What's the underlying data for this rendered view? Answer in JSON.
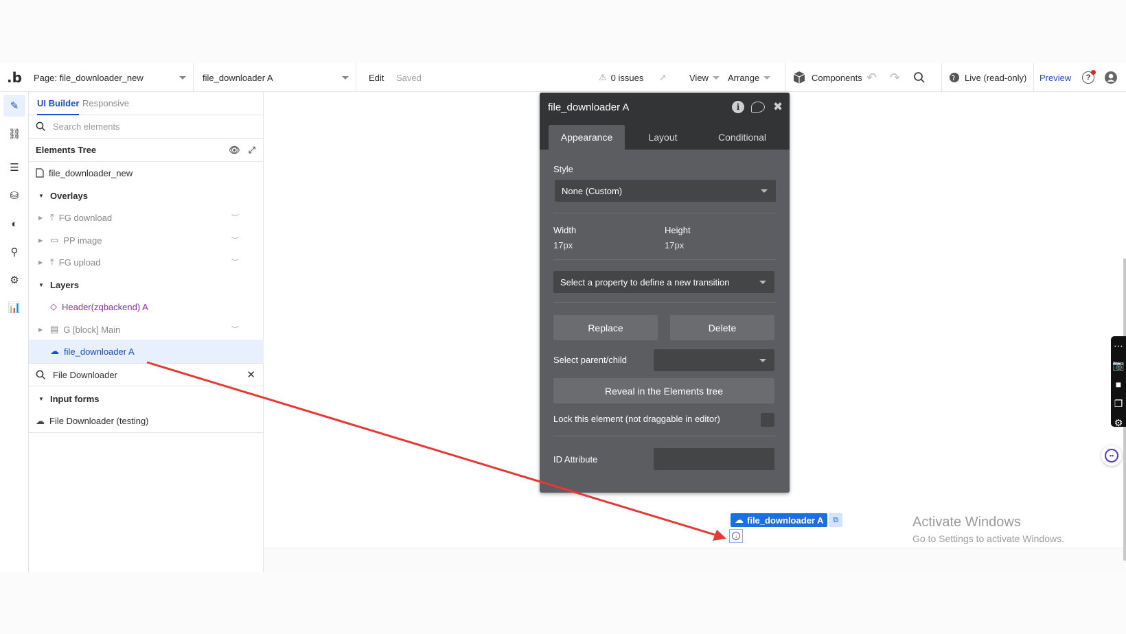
{
  "topbar": {
    "logo": ".b",
    "page_label": "Page: file_downloader_new",
    "element_label": "file_downloader A",
    "edit": "Edit",
    "saved": "Saved",
    "issues": "0 issues",
    "view": "View",
    "arrange": "Arrange",
    "components": "Components",
    "live": "Live (read-only)",
    "preview": "Preview"
  },
  "left_panel": {
    "tab_ui_builder": "UI Builder",
    "tab_responsive": "Responsive",
    "search_placeholder": "Search elements",
    "elements_tree": "Elements Tree",
    "page_item": "file_downloader_new",
    "overlays": "Overlays",
    "overlay_items": [
      "FG download",
      "PP image",
      "FG upload"
    ],
    "layers": "Layers",
    "layer_items": [
      "Header(zqbackend) A",
      "G [block] Main",
      "file_downloader A"
    ],
    "plugin_search_value": "File Downloader",
    "input_forms": "Input forms",
    "input_form_item": "File Downloader (testing)"
  },
  "property_editor": {
    "title": "file_downloader A",
    "tabs": [
      "Appearance",
      "Layout",
      "Conditional"
    ],
    "style_label": "Style",
    "style_value": "None (Custom)",
    "width_label": "Width",
    "width_value": "17px",
    "height_label": "Height",
    "height_value": "17px",
    "transition_placeholder": "Select a property to define a new transition",
    "replace": "Replace",
    "delete": "Delete",
    "parent_child_label": "Select parent/child",
    "reveal": "Reveal in the Elements tree",
    "lock_label": "Lock this element (not draggable in editor)",
    "id_label": "ID Attribute"
  },
  "canvas": {
    "element_badge": "file_downloader A"
  },
  "watermark": {
    "line1": "Activate Windows",
    "line2": "Go to Settings to activate Windows."
  },
  "colors": {
    "accent": "#1b4ccf",
    "badge": "#1b6fe0",
    "arrow": "#e53935",
    "editor_bg": "#5b5d60"
  }
}
